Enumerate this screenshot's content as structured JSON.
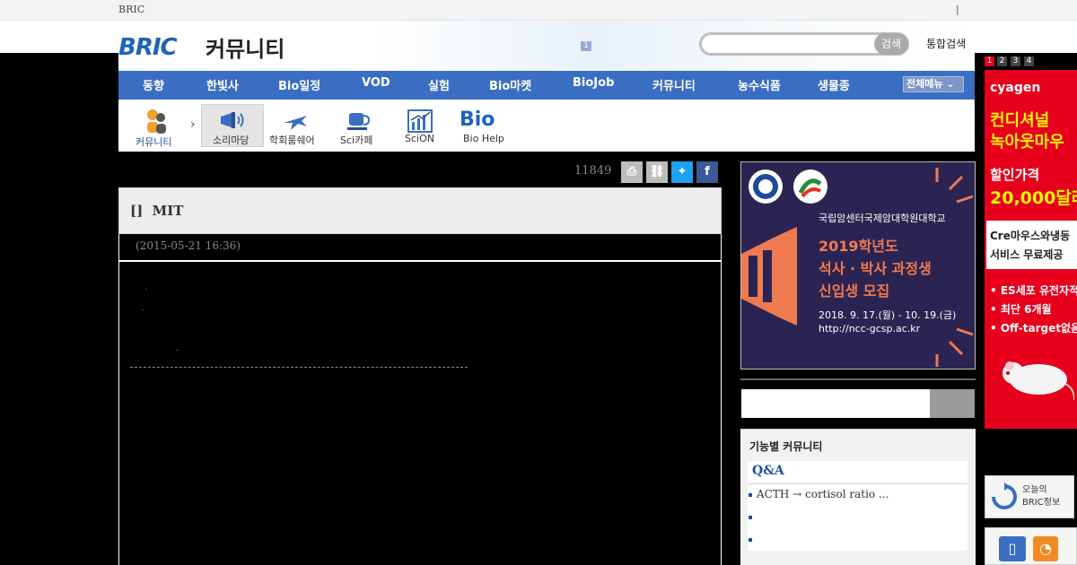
{
  "topbar": {
    "brand": "BRIC",
    "separator": "|"
  },
  "header": {
    "logo": "BRIC",
    "section_title": "커뮤니티",
    "notice_badge": "1",
    "search_button": "검색",
    "search_placeholder": "",
    "total_search": "통합검색"
  },
  "gnb": {
    "items": [
      "동향",
      "한빛사",
      "Bio일정",
      "VOD",
      "실험",
      "Bio마켓",
      "BioJob",
      "커뮤니티",
      "농수식품",
      "생물종"
    ],
    "all_menu": "전체메뉴"
  },
  "subnav": {
    "items": [
      {
        "label": "커뮤니티",
        "icon": "community-icon"
      },
      {
        "label": "소리마당",
        "icon": "megaphone-icon"
      },
      {
        "label": "학회룸쉐어",
        "icon": "airplane-icon"
      },
      {
        "label": "Sci카페",
        "icon": "coffee-cup-icon"
      },
      {
        "label": "SciON",
        "icon": "chart-icon"
      },
      {
        "label": "Bio Help",
        "icon": "bio-help-icon"
      }
    ]
  },
  "post": {
    "view_count": "11849",
    "title_bracket": "[]",
    "title": "MIT",
    "date": "(2015-05-21 16:36)"
  },
  "share": {
    "print": "print-icon",
    "link": "link-icon",
    "twitter": "twitter-icon",
    "facebook": "facebook-icon"
  },
  "banner": {
    "school": "국립암센터국제암대학원대학교",
    "line1": "2019학년도",
    "line2": "석사 · 박사 과정생",
    "line3": "신입생 모집",
    "dates": "2018. 9. 17.(월) - 10. 19.(금)",
    "url": "http://ncc-gcsp.ac.kr"
  },
  "ad": {
    "pages": [
      "1",
      "2",
      "3",
      "4"
    ],
    "brand": "cyagen",
    "line1": "컨디셔널",
    "line2": "녹아웃마우",
    "price_label": "할인가격",
    "price": "20,000달러",
    "offer1": "Cre마우스와냉동",
    "offer2": "서비스 무료제공",
    "bullet1": "• ES세포 유전자적",
    "bullet2": "• 최단 6개월",
    "bullet3": "• Off-target없음"
  },
  "sidebar": {
    "box_title": "기능별 커뮤니티",
    "qa_title": "Q&A",
    "qa_items": [
      "ACTH → cortisol ratio  ...",
      "",
      ""
    ]
  },
  "right_widgets": {
    "info_label_1": "오늘의",
    "info_label_2": "BRIC정보"
  },
  "colors": {
    "nav_blue": "#3a6ec2",
    "logo_blue": "#1e63b6",
    "banner_bg": "#2b2453",
    "banner_orange": "#f07a50",
    "ad_red": "#e7001c"
  }
}
